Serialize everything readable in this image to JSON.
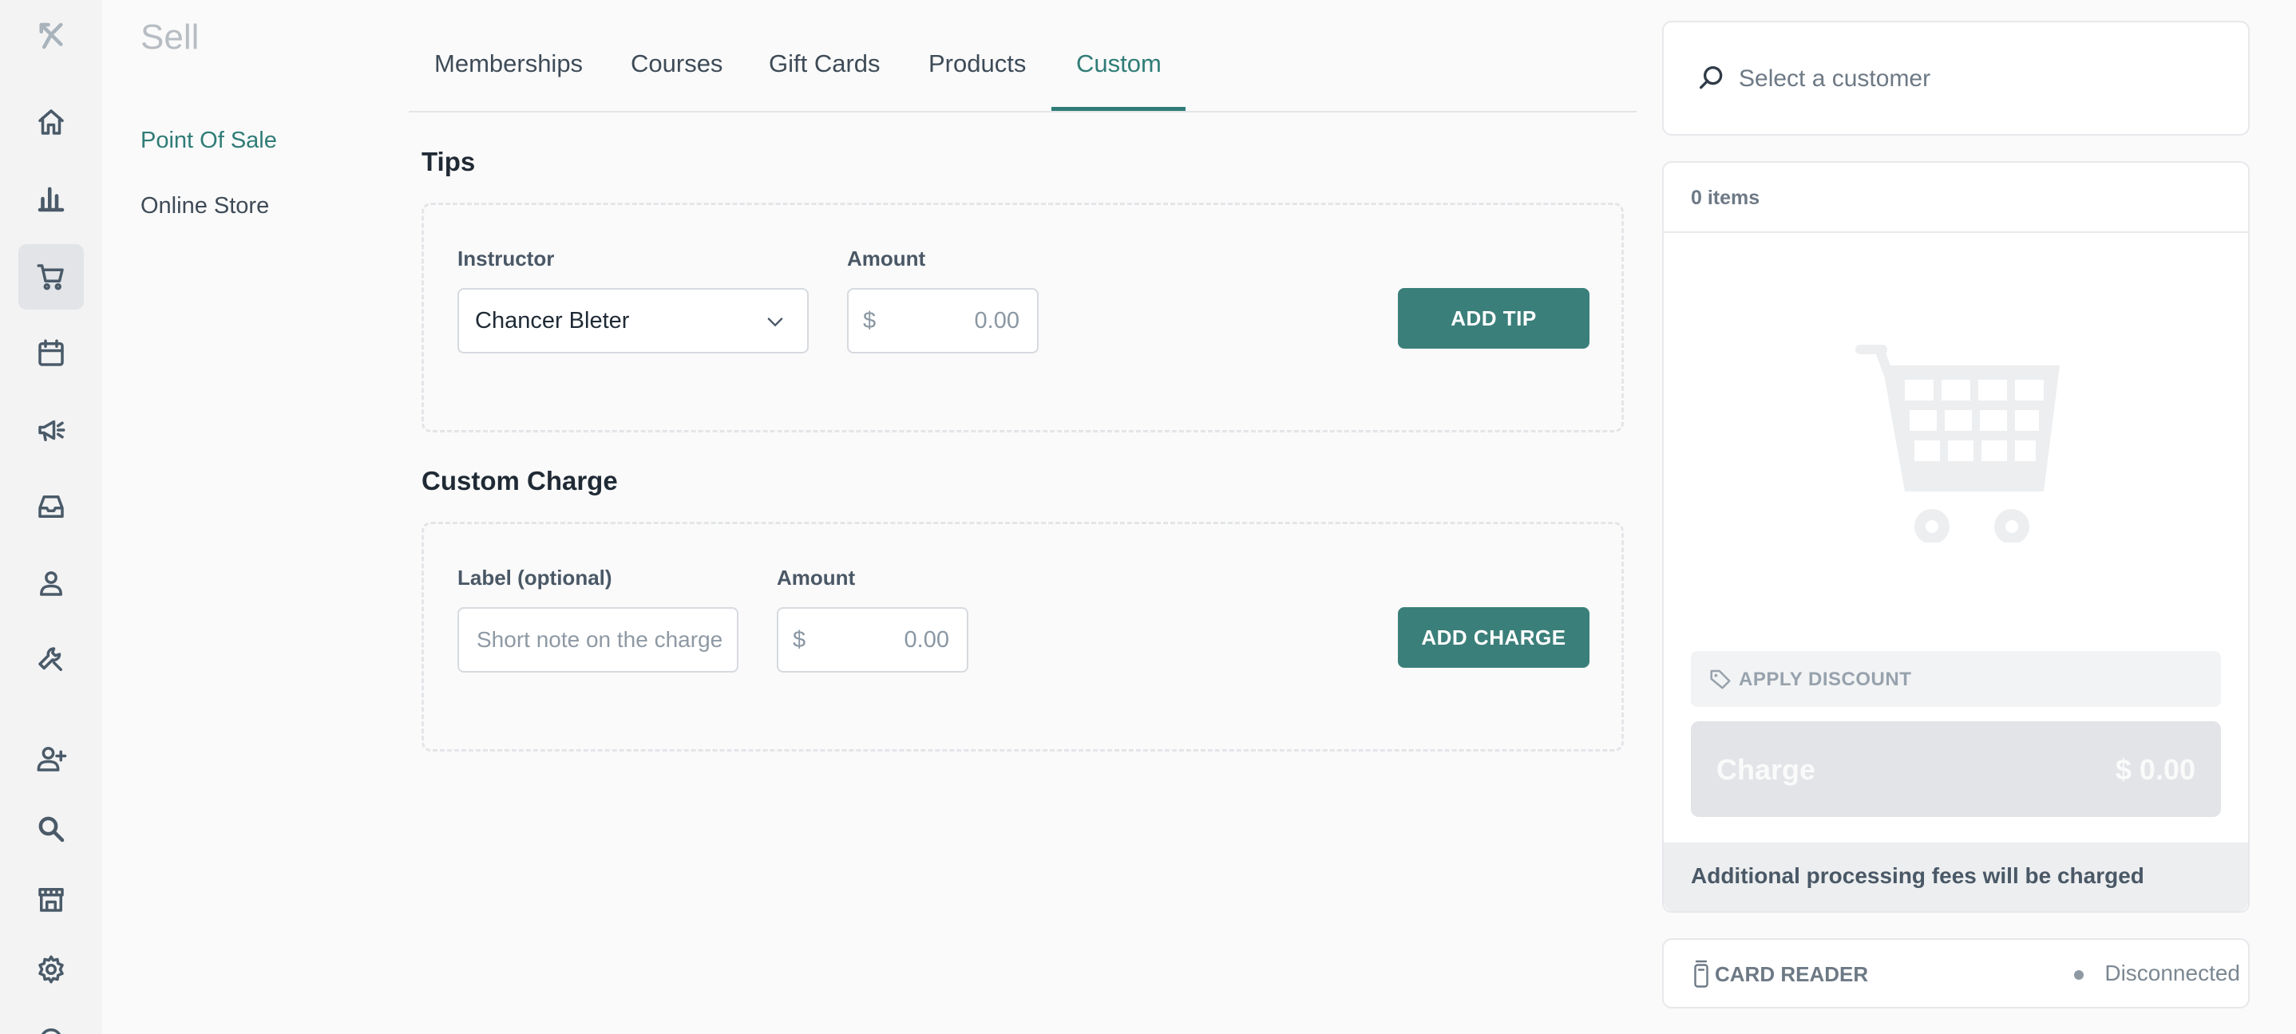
{
  "rail": {
    "items": [
      {
        "icon": "logo-icon"
      },
      {
        "icon": "home-icon"
      },
      {
        "icon": "bar-chart-icon"
      },
      {
        "icon": "cart-icon",
        "active": true
      },
      {
        "icon": "calendar-icon"
      },
      {
        "icon": "megaphone-icon"
      },
      {
        "icon": "inbox-icon"
      },
      {
        "icon": "person-icon"
      },
      {
        "icon": "wrench-icon"
      },
      {
        "icon": "add-user-icon"
      },
      {
        "icon": "search-icon"
      },
      {
        "icon": "store-icon"
      },
      {
        "icon": "gear-icon"
      },
      {
        "icon": "help-icon"
      }
    ]
  },
  "subnav": {
    "title": "Sell",
    "items": [
      "Point Of Sale",
      "Online Store"
    ],
    "active": "Point Of Sale"
  },
  "tabs": {
    "items": [
      "Memberships",
      "Courses",
      "Gift Cards",
      "Products",
      "Custom"
    ],
    "active": "Custom"
  },
  "tips": {
    "title": "Tips",
    "instructor_label": "Instructor",
    "instructor_value": "Chancer Bleter",
    "amount_label": "Amount",
    "currency": "$",
    "amount_value": "0.00",
    "button": "ADD TIP"
  },
  "custom_charge": {
    "title": "Custom Charge",
    "label_label": "Label (optional)",
    "label_placeholder": "Short note on the charge",
    "amount_label": "Amount",
    "currency": "$",
    "amount_value": "0.00",
    "button": "ADD CHARGE"
  },
  "customer": {
    "placeholder": "Select a customer"
  },
  "cart": {
    "items_count": "0 items",
    "apply_discount": "APPLY DISCOUNT",
    "charge_label": "Charge",
    "charge_amount": "$ 0.00",
    "fees_note": "Additional processing fees will be charged"
  },
  "card_reader": {
    "label": "CARD READER",
    "status": "Disconnected"
  },
  "colors": {
    "accent": "#2f7c77",
    "button": "#3b7f7a",
    "rail_bg": "#f3f3f4"
  }
}
